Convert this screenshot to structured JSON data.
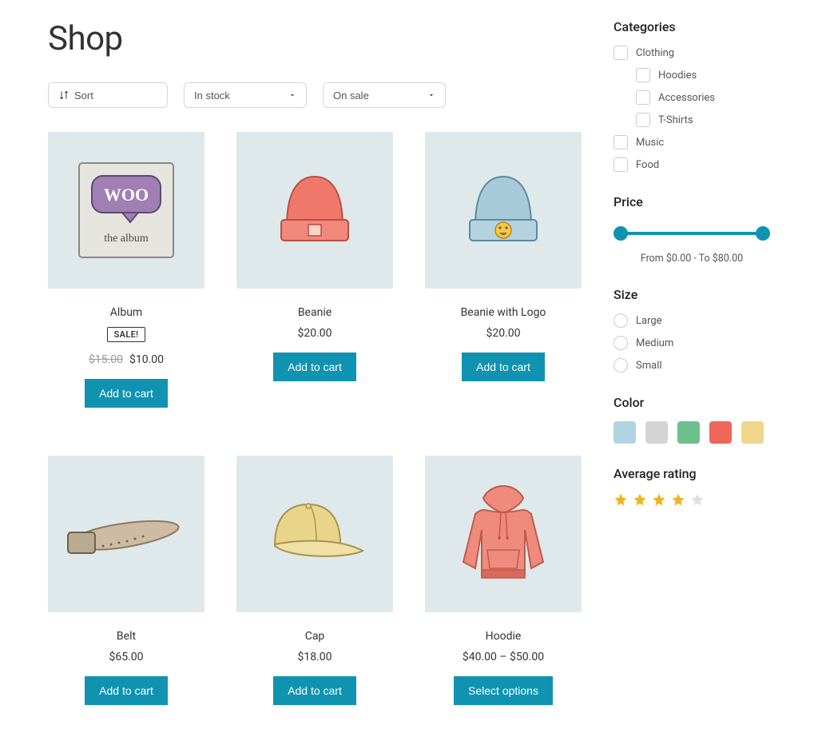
{
  "header": {
    "title": "Shop"
  },
  "filters": {
    "sort_label": "Sort",
    "selects": [
      "In stock",
      "On sale"
    ]
  },
  "products": [
    {
      "name": "Album",
      "sale": "SALE!",
      "old_price": "$15.00",
      "price": "$10.00",
      "button": "Add to cart",
      "img": "album"
    },
    {
      "name": "Beanie",
      "price": "$20.00",
      "button": "Add to cart",
      "img": "beanie"
    },
    {
      "name": "Beanie with Logo",
      "price": "$20.00",
      "button": "Add to cart",
      "img": "beanie-logo"
    },
    {
      "name": "Belt",
      "price": "$65.00",
      "button": "Add to cart",
      "img": "belt"
    },
    {
      "name": "Cap",
      "price": "$18.00",
      "button": "Add to cart",
      "img": "cap"
    },
    {
      "name": "Hoodie",
      "price": "$40.00 – $50.00",
      "button": "Select options",
      "img": "hoodie"
    }
  ],
  "sidebar": {
    "categories_title": "Categories",
    "categories": [
      {
        "label": "Clothing",
        "sub": false
      },
      {
        "label": "Hoodies",
        "sub": true
      },
      {
        "label": "Accessories",
        "sub": true
      },
      {
        "label": "T-Shirts",
        "sub": true
      },
      {
        "label": "Music",
        "sub": false
      },
      {
        "label": "Food",
        "sub": false
      }
    ],
    "price_title": "Price",
    "price_label": "From $0.00 - To $80.00",
    "size_title": "Size",
    "sizes": [
      "Large",
      "Medium",
      "Small"
    ],
    "color_title": "Color",
    "colors": [
      "#b1d4e0",
      "#d4d4d4",
      "#6fbf8e",
      "#f0665a",
      "#f0d68a"
    ],
    "rating_title": "Average rating",
    "rating": {
      "filled": 4,
      "total": 5,
      "filled_color": "#f0b41e",
      "empty_color": "#e0e0e0"
    }
  }
}
